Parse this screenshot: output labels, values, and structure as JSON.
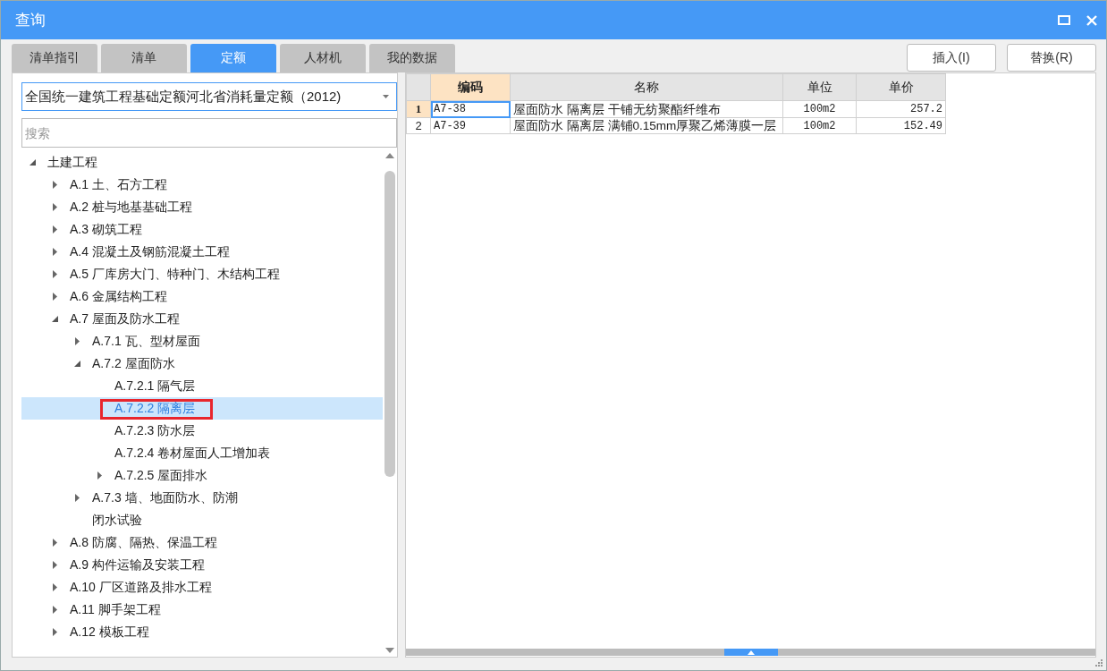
{
  "window": {
    "title": "查询"
  },
  "tabs": [
    {
      "label": "清单指引",
      "selected": false
    },
    {
      "label": "清单",
      "selected": false
    },
    {
      "label": "定额",
      "selected": true
    },
    {
      "label": "人材机",
      "selected": false
    },
    {
      "label": "我的数据",
      "selected": false
    }
  ],
  "library_dropdown": {
    "value": "全国统一建筑工程基础定额河北省消耗量定额（2012)"
  },
  "search": {
    "placeholder": "搜索"
  },
  "tree": [
    {
      "label": "土建工程",
      "kind": "branch",
      "expanded": true,
      "selected": false,
      "children": [
        {
          "label": "A.1 土、石方工程",
          "kind": "branch",
          "expanded": false,
          "selected": false
        },
        {
          "label": "A.2 桩与地基基础工程",
          "kind": "branch",
          "expanded": false,
          "selected": false
        },
        {
          "label": "A.3 砌筑工程",
          "kind": "branch",
          "expanded": false,
          "selected": false
        },
        {
          "label": "A.4 混凝土及钢筋混凝土工程",
          "kind": "branch",
          "expanded": false,
          "selected": false
        },
        {
          "label": "A.5 厂库房大门、特种门、木结构工程",
          "kind": "branch",
          "expanded": false,
          "selected": false
        },
        {
          "label": "A.6 金属结构工程",
          "kind": "branch",
          "expanded": false,
          "selected": false
        },
        {
          "label": "A.7 屋面及防水工程",
          "kind": "branch",
          "expanded": true,
          "selected": false,
          "children": [
            {
              "label": "A.7.1 瓦、型材屋面",
              "kind": "branch",
              "expanded": false,
              "selected": false
            },
            {
              "label": "A.7.2 屋面防水",
              "kind": "branch",
              "expanded": true,
              "selected": false,
              "children": [
                {
                  "label": "A.7.2.1 隔气层",
                  "kind": "leaf",
                  "selected": false
                },
                {
                  "label": "A.7.2.2 隔离层",
                  "kind": "leaf",
                  "selected": true
                },
                {
                  "label": "A.7.2.3 防水层",
                  "kind": "leaf",
                  "selected": false
                },
                {
                  "label": "A.7.2.4 卷材屋面人工增加表",
                  "kind": "leaf",
                  "selected": false
                },
                {
                  "label": "A.7.2.5 屋面排水",
                  "kind": "branch",
                  "expanded": false,
                  "selected": false
                }
              ]
            },
            {
              "label": "A.7.3 墙、地面防水、防潮",
              "kind": "branch",
              "expanded": false,
              "selected": false
            },
            {
              "label": "闭水试验",
              "kind": "leaf",
              "selected": false
            }
          ]
        },
        {
          "label": "A.8 防腐、隔热、保温工程",
          "kind": "branch",
          "expanded": false,
          "selected": false
        },
        {
          "label": "A.9 构件运输及安装工程",
          "kind": "branch",
          "expanded": false,
          "selected": false
        },
        {
          "label": "A.10 厂区道路及排水工程",
          "kind": "branch",
          "expanded": false,
          "selected": false
        },
        {
          "label": "A.11 脚手架工程",
          "kind": "branch",
          "expanded": false,
          "selected": false
        },
        {
          "label": "A.12 模板工程",
          "kind": "branch",
          "expanded": false,
          "selected": false
        }
      ]
    }
  ],
  "buttons": [
    {
      "label": "插入(I)"
    },
    {
      "label": "替换(R)"
    }
  ],
  "table": {
    "columns": [
      {
        "label": "编码",
        "selected": true
      },
      {
        "label": "名称",
        "selected": false
      },
      {
        "label": "单位",
        "selected": false
      },
      {
        "label": "单价",
        "selected": false
      }
    ],
    "rows": [
      {
        "number": "1",
        "selected": true,
        "cells": [
          "A7-38",
          "屋面防水 隔离层 干铺无纺聚酯纤维布",
          "100m2",
          "257.2"
        ]
      },
      {
        "number": "2",
        "selected": false,
        "cells": [
          "A7-39",
          "屋面防水 隔离层 满铺0.15mm厚聚乙烯薄膜一层",
          "100m2",
          "152.49"
        ]
      }
    ]
  }
}
